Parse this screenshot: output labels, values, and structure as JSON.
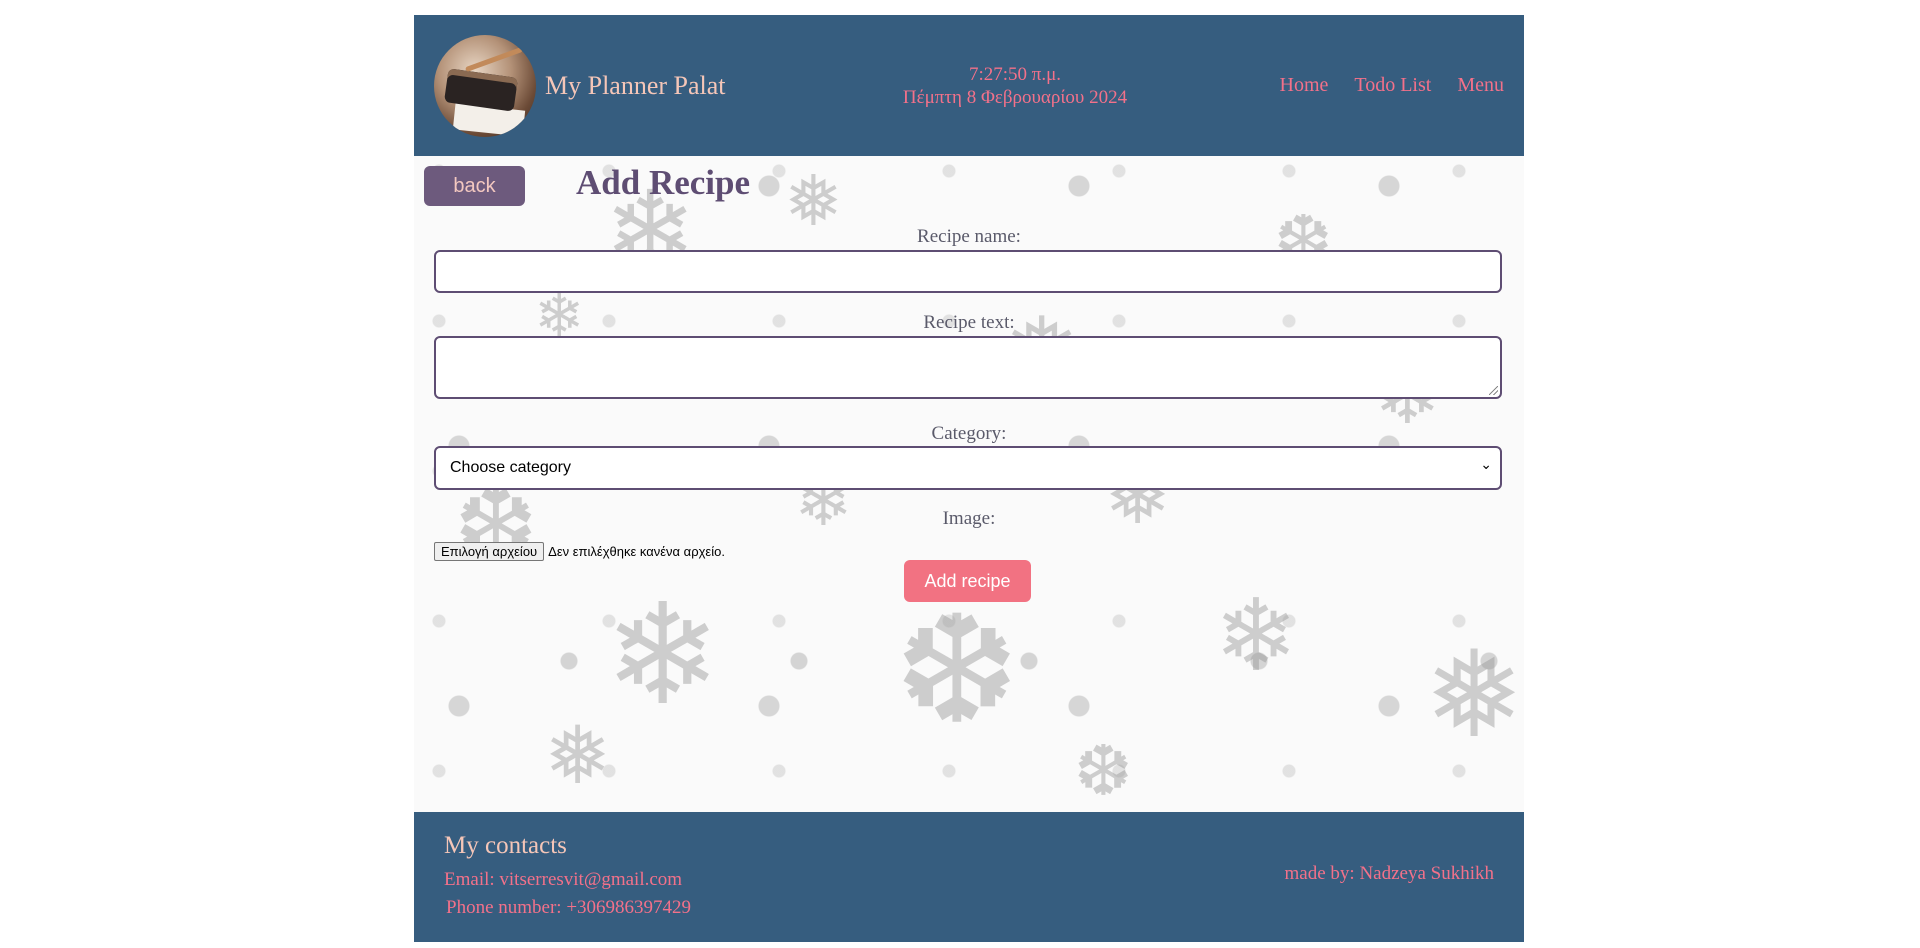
{
  "header": {
    "brand": "My Planner Palat",
    "time": "7:27:50 π.μ.",
    "date": "Πέμπτη 8 Φεβρουαρίου 2024",
    "nav": [
      "Home",
      "Todo List",
      "Menu"
    ]
  },
  "form": {
    "back_label": "back",
    "title": "Add Recipe",
    "name_label": "Recipe name:",
    "name_value": "",
    "text_label": "Recipe text:",
    "text_value": "",
    "category_label": "Category:",
    "category_selected": "Choose category",
    "image_label": "Image:",
    "file_button": "Επιλογή αρχείου",
    "file_status": "Δεν επιλέχθηκε κανένα αρχείο.",
    "submit_label": "Add recipe"
  },
  "footer": {
    "heading": "My contacts",
    "email": "Email: vitserresvit@gmail.com",
    "phone": "Phone number: +306986397429",
    "made_by": "made by: Nadzeya Sukhikh"
  },
  "colors": {
    "header_bg": "#365d7f",
    "accent_pink": "#f3718a",
    "back_button": "#6d5a7d",
    "title": "#5e4d73",
    "submit_button": "#f27282"
  }
}
